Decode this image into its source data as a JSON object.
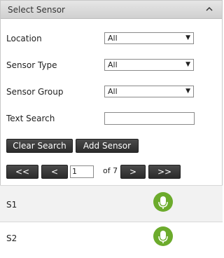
{
  "panel": {
    "title": "Select Sensor",
    "collapse_icon": "chevron-up-icon"
  },
  "filters": {
    "location": {
      "label": "Location",
      "value": "All"
    },
    "sensor_type": {
      "label": "Sensor Type",
      "value": "All"
    },
    "sensor_group": {
      "label": "Sensor Group",
      "value": "All"
    },
    "text_search": {
      "label": "Text Search",
      "value": ""
    }
  },
  "actions": {
    "clear_search": "Clear Search",
    "add_sensor": "Add Sensor"
  },
  "pager": {
    "first": "<<",
    "prev": "<",
    "current_page": "1",
    "of_label": "of 7",
    "next": ">",
    "last": ">>"
  },
  "sensors": [
    {
      "name": "S1",
      "status_icon": "microphone-icon",
      "status_color": "#6cab2c"
    },
    {
      "name": "S2",
      "status_icon": "microphone-icon",
      "status_color": "#6cab2c"
    }
  ]
}
